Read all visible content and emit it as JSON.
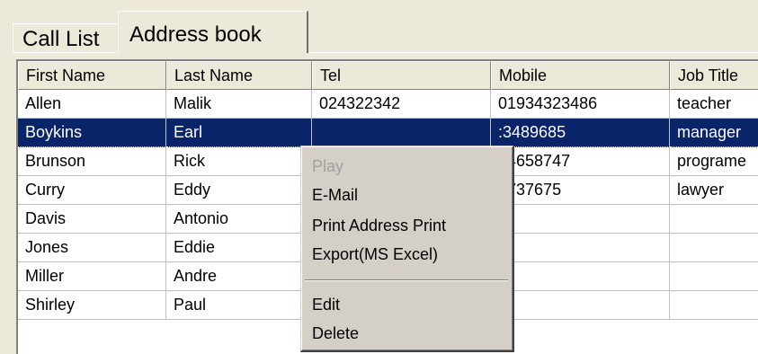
{
  "tabs": {
    "call_list": "Call List",
    "address_book": "Address book"
  },
  "grid": {
    "headers": [
      "First Name",
      "Last Name",
      "Tel",
      "Mobile",
      "Job Title"
    ],
    "rows": [
      [
        "Allen",
        "Malik",
        "024322342",
        "01934323486",
        "teacher"
      ],
      [
        "Boykins",
        "Earl",
        "",
        "01923489685",
        "manager"
      ],
      [
        "Brunson",
        "Rick",
        "",
        "74658747",
        "programe"
      ],
      [
        "Curry",
        "Eddy",
        "",
        "8737675",
        "lawyer"
      ],
      [
        "Davis",
        "Antonio",
        "",
        "",
        ""
      ],
      [
        "Jones",
        "Eddie",
        "",
        "",
        ""
      ],
      [
        "Miller",
        "Andre",
        "",
        "",
        ""
      ],
      [
        "Shirley",
        "Paul",
        "",
        "",
        ""
      ]
    ],
    "mobile_visible": [
      "01934323486",
      ":3489685",
      "74658747",
      "8737675"
    ],
    "selected_row": 1
  },
  "context_menu": {
    "items": [
      "Play",
      "E-Mail",
      "Print Address Print",
      "Export(MS Excel)",
      "Edit",
      "Delete"
    ],
    "disabled": [
      "Play"
    ]
  },
  "colors": {
    "selection": "#0a246a",
    "window_bg": "#ece9d8",
    "menu_bg": "#d4d0c8"
  }
}
